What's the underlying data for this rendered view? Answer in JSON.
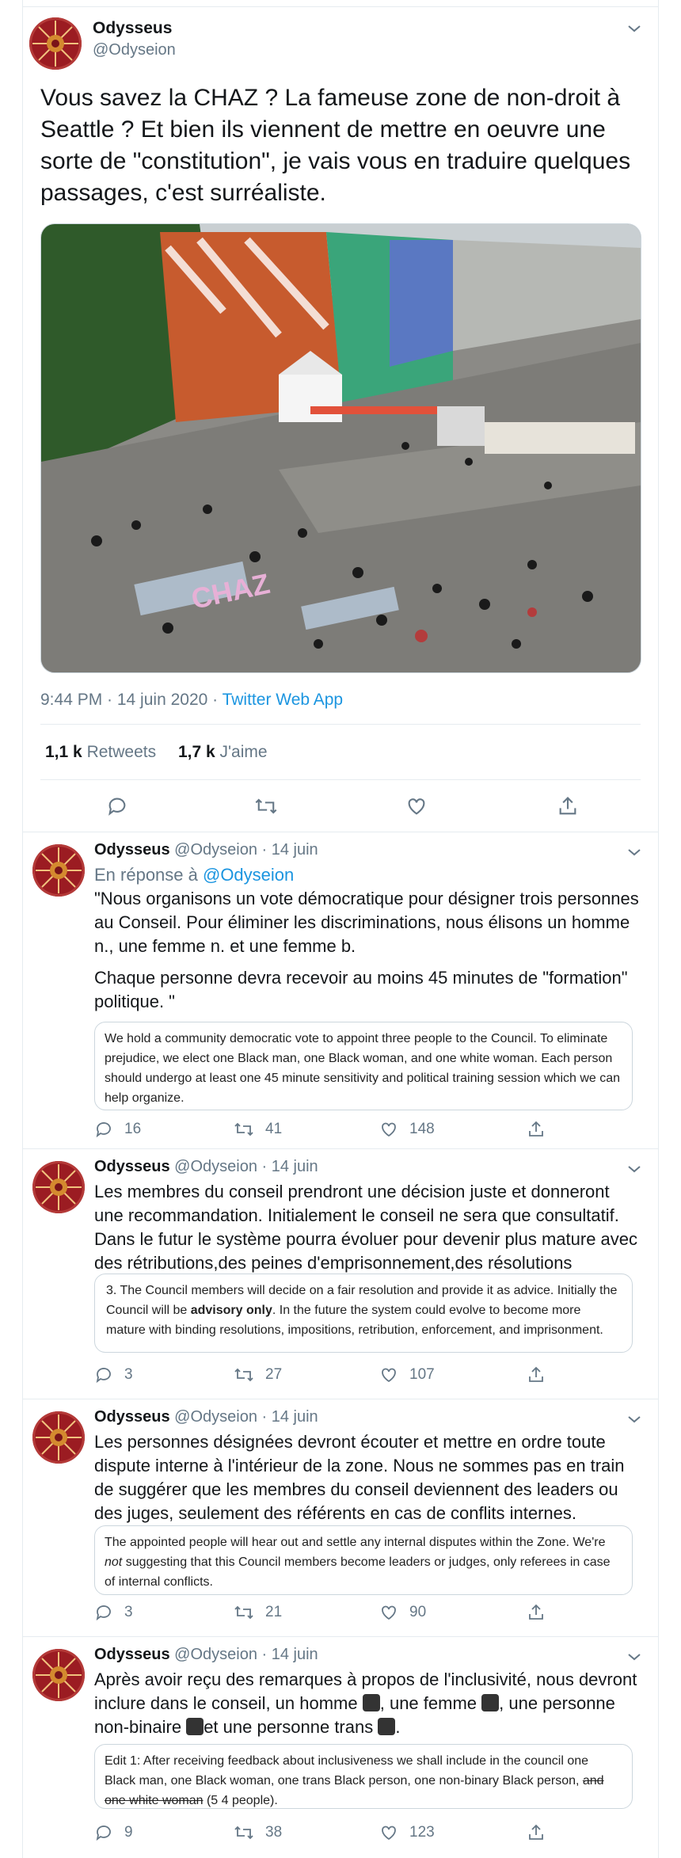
{
  "main_tweet": {
    "name": "Odysseus",
    "handle": "@Odyseion",
    "text": "Vous savez la CHAZ ? La fameuse zone de non-droit à Seattle ? Et bien ils viennent de mettre en oeuvre une sorte de \"constitution\", je vais vous en traduire quelques passages, c'est surréaliste.",
    "time": "9:44 PM · 14 juin 2020 · ",
    "app": "Twitter Web App",
    "retweets_count": "1,1 k",
    "retweets_label": "Retweets",
    "likes_count": "1,7 k",
    "likes_label": "J'aime",
    "photo_text": "CHAZ"
  },
  "replies": [
    {
      "name": "Odysseus",
      "handle_date": "@Odyseion · 14 juin",
      "reply_prefix": "En réponse à ",
      "reply_to": "@Odyseion",
      "text1": "\"Nous organisons un vote démocratique pour désigner trois personnes au Conseil. Pour éliminer les discriminations, nous élisons un homme n., une femme n. et une femme b.",
      "text2": "Chaque personne devra recevoir au moins 45 minutes de \"formation\" politique. \"",
      "quote": "We hold a community democratic vote to appoint three people to the Council. To eliminate prejudice, we elect one Black man, one Black woman, and one white woman. Each person should undergo at least one 45 minute sensitivity and political training session which we can help organize.",
      "replies": "16",
      "retweets": "41",
      "likes": "148"
    },
    {
      "name": "Odysseus",
      "handle_date": "@Odyseion · 14 juin",
      "text1": "Les membres du conseil prendront une décision juste et donneront une recommandation. Initialement le conseil ne sera que consultatif. Dans le futur le système pourra évoluer pour devenir plus mature avec des rétributions,des peines d'emprisonnement,des résolutions contraignantes.",
      "quote_a": "3. The Council members will decide on a fair resolution and provide it as advice. Initially the Council will be ",
      "quote_bold": "advisory only",
      "quote_b": ". In the future the system could evolve to become more mature with binding resolutions, impositions, retribution, enforcement, and imprisonment.",
      "replies": "3",
      "retweets": "27",
      "likes": "107"
    },
    {
      "name": "Odysseus",
      "handle_date": "@Odyseion · 14 juin",
      "text1": "Les personnes désignées devront écouter et mettre en ordre toute dispute interne à l'intérieur de la zone. Nous ne sommes pas en train de suggérer que les membres du conseil deviennent des leaders ou des juges, seulement des référents en cas de conflits internes.",
      "quote_a": "The appointed people will hear out and settle any internal disputes within the Zone. We're ",
      "quote_italic": "not",
      "quote_b": " suggesting that this Council members become leaders or judges, only referees in case of internal conflicts.",
      "replies": "3",
      "retweets": "21",
      "likes": "90"
    },
    {
      "name": "Odysseus",
      "handle_date": "@Odyseion · 14 juin",
      "text_a": "Après avoir reçu des remarques à propos de l'inclusivité, nous devront inclure dans le conseil, un homme ",
      "text_b": ", une femme ",
      "text_c": ", une personne non-binaire ",
      "text_d": "et une personne trans ",
      "text_e": ".",
      "quote_a": "Edit 1: After receiving feedback about inclusiveness we shall include in the council one Black man, one Black woman, one trans Black person, one non-binary Black person, ",
      "quote_strike": "and one white woman",
      "quote_b": " (5 4 people).",
      "replies": "9",
      "retweets": "38",
      "likes": "123"
    }
  ]
}
